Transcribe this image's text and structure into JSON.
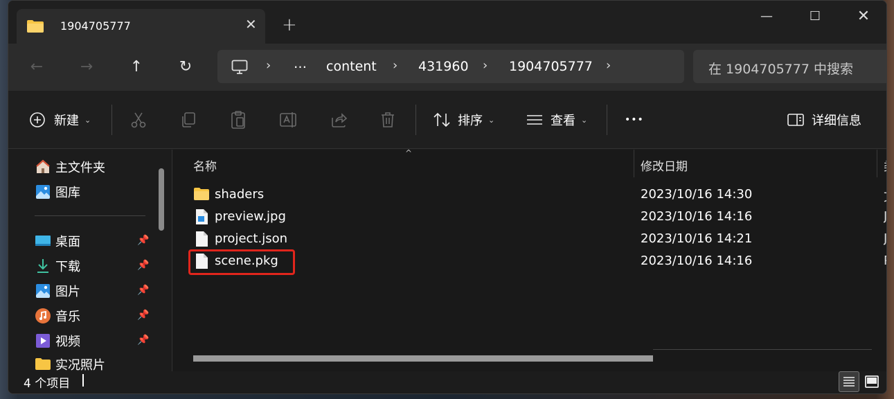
{
  "window": {
    "tab_title": "1904705777",
    "tab_close": "✕",
    "new_tab": "+",
    "controls": {
      "minimize": "—",
      "maximize": "☐",
      "close": "✕"
    }
  },
  "nav": {
    "back": "←",
    "forward": "→",
    "up": "↑",
    "refresh": "↻",
    "breadcrumbs": [
      "…",
      "content",
      "431960",
      "1904705777"
    ],
    "separator": "›",
    "search_placeholder": "在 1904705777 中搜索"
  },
  "toolbar": {
    "new_label": "新建",
    "sort_label": "排序",
    "view_label": "查看",
    "more_label": "•••",
    "details_label": "详细信息"
  },
  "sidebar": {
    "top_items": [
      {
        "label": "主文件夹",
        "icon": "home-icon"
      },
      {
        "label": "图库",
        "icon": "gallery-icon"
      }
    ],
    "pinned_items": [
      {
        "label": "桌面",
        "icon": "desktop-icon"
      },
      {
        "label": "下载",
        "icon": "download-icon"
      },
      {
        "label": "图片",
        "icon": "pictures-icon"
      },
      {
        "label": "音乐",
        "icon": "music-icon"
      },
      {
        "label": "视频",
        "icon": "videos-icon"
      },
      {
        "label": "实况照片",
        "icon": "folder-icon"
      }
    ]
  },
  "columns": {
    "name": "名称",
    "modified": "修改日期",
    "type": "类"
  },
  "files": [
    {
      "name": "shaders",
      "date": "2023/10/16 14:30",
      "type": "文",
      "icon": "folder-icon"
    },
    {
      "name": "preview.jpg",
      "date": "2023/10/16 14:16",
      "type": "J",
      "icon": "image-file-icon"
    },
    {
      "name": "project.json",
      "date": "2023/10/16 14:21",
      "type": "J",
      "icon": "file-icon"
    },
    {
      "name": "scene.pkg",
      "date": "2023/10/16 14:16",
      "type": "P",
      "icon": "file-icon"
    }
  ],
  "status": {
    "item_count": "4 个项目"
  },
  "colors": {
    "highlight": "#e0251c",
    "folder": "#f7c544"
  }
}
